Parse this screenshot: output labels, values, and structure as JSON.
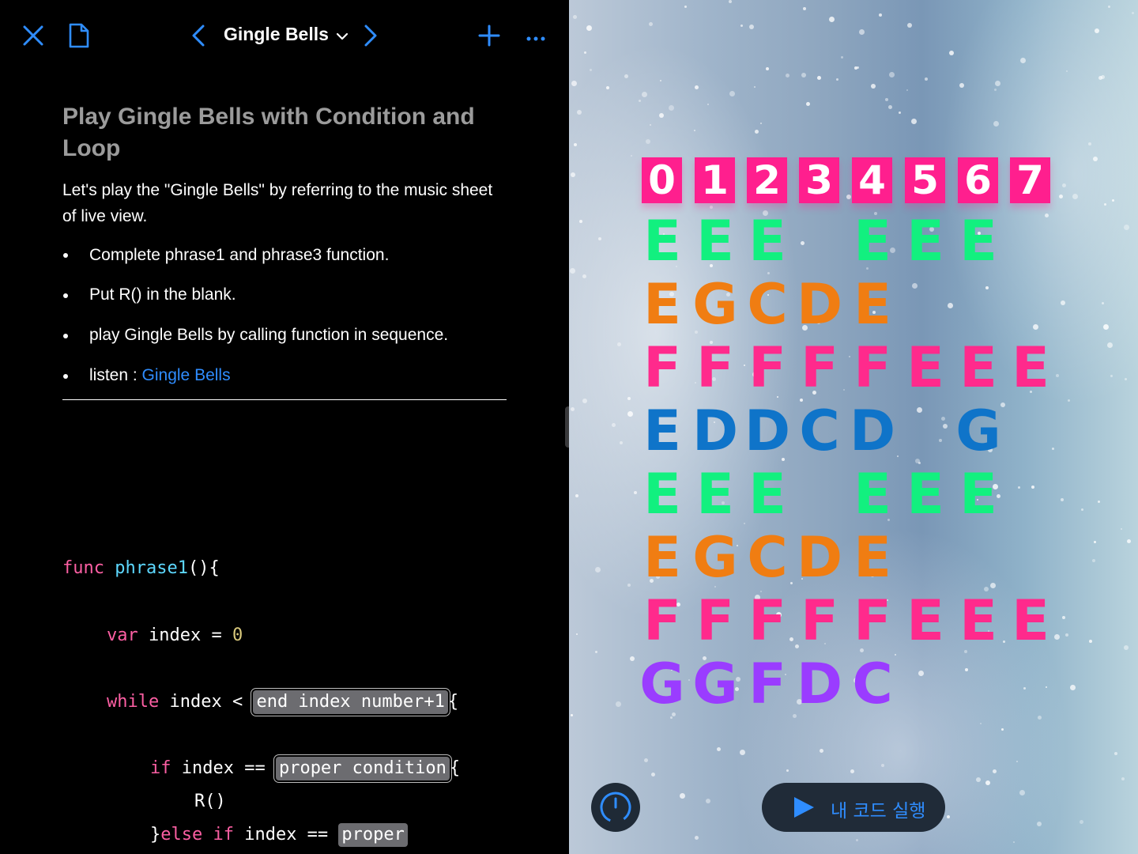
{
  "nav": {
    "title": "Gingle Bells"
  },
  "doc": {
    "heading": "Play Gingle Bells with Condition and Loop",
    "intro": "Let's play the \"Gingle Bells\" by referring to the music sheet of live view.",
    "bullets": [
      "Complete phrase1 and phrase3 function.",
      "Put R() in the blank.",
      "play Gingle Bells by calling function in sequence."
    ],
    "listen_prefix": "listen : ",
    "listen_link": "Gingle Bells"
  },
  "code": {
    "l1_kw": "func",
    "l1_fn": "phrase1",
    "l1_rest": "(){",
    "l2_kw": "var",
    "l2_rest": " index = ",
    "l2_num": "0",
    "l3_kw": "while",
    "l3_rest": " index < ",
    "l3_ph": "end index number+1",
    "l3_end": "{",
    "l4_kw": "if",
    "l4_rest": " index == ",
    "l4_ph": "proper condition",
    "l4_end": "{",
    "l5": "R()",
    "l6_brace": "}",
    "l6_kw": "else if",
    "l6_rest": " index == ",
    "l6_ph": "proper"
  },
  "live_view": {
    "digits": [
      "0",
      "1",
      "2",
      "3",
      "4",
      "5",
      "6",
      "7"
    ],
    "digit_color": "#ff1f8e",
    "rows": [
      {
        "color": "#12f07f",
        "notes": [
          "E",
          "E",
          "E",
          "",
          "E",
          "E",
          "E",
          ""
        ]
      },
      {
        "color": "#f07d12",
        "notes": [
          "E",
          "G",
          "C",
          "D",
          "E",
          "",
          "",
          ""
        ]
      },
      {
        "color": "#ff2a8c",
        "notes": [
          "F",
          "F",
          "F",
          "F",
          "F",
          "E",
          "E",
          "E"
        ]
      },
      {
        "color": "#0f74c9",
        "notes": [
          "E",
          "D",
          "D",
          "C",
          "D",
          "",
          "G",
          ""
        ]
      },
      {
        "color": "#12f07f",
        "notes": [
          "E",
          "E",
          "E",
          "",
          "E",
          "E",
          "E",
          ""
        ]
      },
      {
        "color": "#f07d12",
        "notes": [
          "E",
          "G",
          "C",
          "D",
          "E",
          "",
          "",
          ""
        ]
      },
      {
        "color": "#ff2a8c",
        "notes": [
          "F",
          "F",
          "F",
          "F",
          "F",
          "E",
          "E",
          "E"
        ]
      },
      {
        "color": "#9a3cff",
        "notes": [
          "G",
          "G",
          "F",
          "D",
          "C",
          "",
          "",
          ""
        ]
      }
    ],
    "run_button_label": "내 코드 실행"
  },
  "colors": {
    "accent": "#2f8dff",
    "keyword": "#fc5fa3",
    "function": "#5dd8ff",
    "number": "#d9c97c"
  }
}
